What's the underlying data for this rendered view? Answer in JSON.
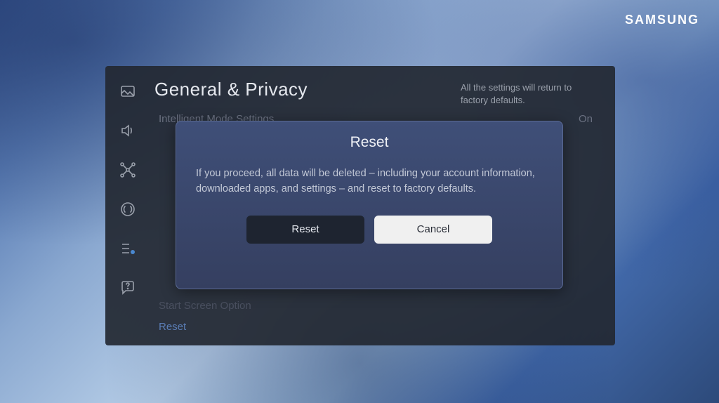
{
  "brand": "SAMSUNG",
  "page": {
    "title": "General & Privacy",
    "description": "All the settings will return to factory defaults."
  },
  "bg_list": {
    "row1_label": "Intelligent Mode Settings",
    "row1_value": "On",
    "start_row": "Start Screen Option",
    "reset_row": "Reset"
  },
  "dialog": {
    "title": "Reset",
    "body": "If you proceed, all data will be deleted – including your account information, downloaded apps, and settings – and reset to factory defaults.",
    "reset_label": "Reset",
    "cancel_label": "Cancel"
  }
}
